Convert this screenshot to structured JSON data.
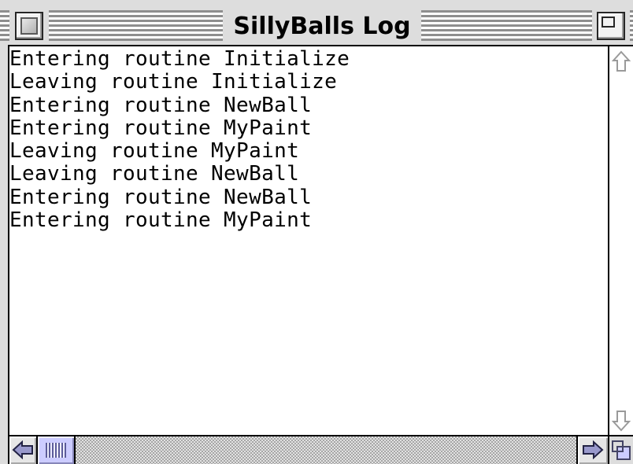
{
  "window": {
    "title": "SillyBalls Log"
  },
  "log": {
    "lines": [
      "Entering routine Initialize",
      "Leaving routine Initialize",
      "Entering routine NewBall",
      "Entering routine MyPaint",
      "Leaving routine MyPaint",
      "Leaving routine NewBall",
      "Entering routine NewBall",
      "Entering routine MyPaint"
    ]
  },
  "scrollbars": {
    "vertical": {
      "enabled": false
    },
    "horizontal": {
      "enabled": true,
      "position": 0
    }
  },
  "icons": {
    "close": "close-box-icon",
    "zoom": "zoom-box-icon",
    "scroll_up": "up-arrow-icon",
    "scroll_down": "down-arrow-icon",
    "scroll_left": "left-arrow-icon",
    "scroll_right": "right-arrow-icon",
    "grow": "grow-box-icon"
  },
  "colors": {
    "frame": "#dddddd",
    "content_background": "#ffffff",
    "text": "#000000",
    "accent_lavender": "#9999cc",
    "scroll_thumb": "#ccccff"
  }
}
